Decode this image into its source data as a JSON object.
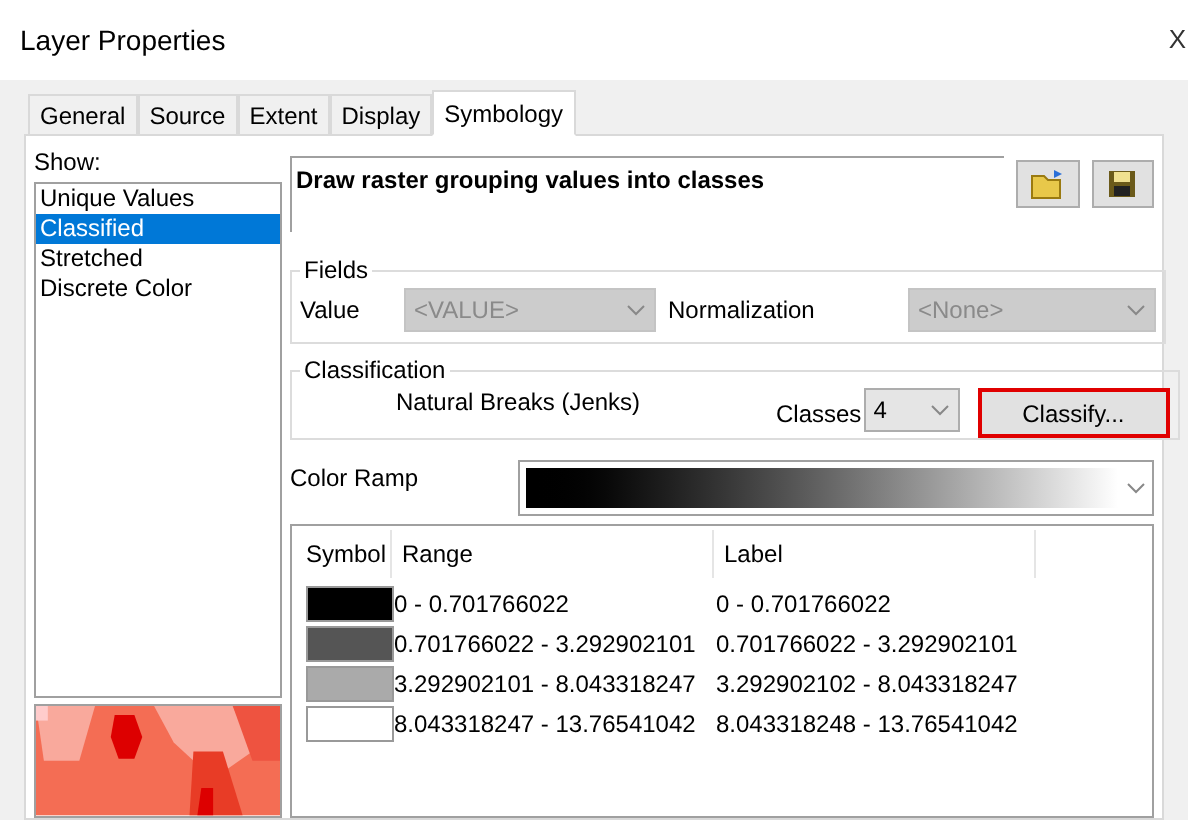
{
  "window": {
    "title": "Layer Properties",
    "close": "X"
  },
  "tabs": [
    {
      "label": "General",
      "selected": false
    },
    {
      "label": "Source",
      "selected": false
    },
    {
      "label": "Extent",
      "selected": false
    },
    {
      "label": "Display",
      "selected": false
    },
    {
      "label": "Symbology",
      "selected": true
    }
  ],
  "show": {
    "label": "Show:",
    "items": [
      {
        "label": "Unique Values",
        "selected": false
      },
      {
        "label": "Classified",
        "selected": true
      },
      {
        "label": "Stretched",
        "selected": false
      },
      {
        "label": "Discrete Color",
        "selected": false
      }
    ]
  },
  "description": "Draw raster grouping values into classes",
  "fields": {
    "title": "Fields",
    "value_label": "Value",
    "value": "<VALUE>",
    "normalization_label": "Normalization",
    "normalization": "<None>"
  },
  "classification": {
    "title": "Classification",
    "method": "Natural Breaks (Jenks)",
    "classes_label": "Classes",
    "classes": "4",
    "classify_button": "Classify..."
  },
  "color_ramp": {
    "label": "Color Ramp"
  },
  "table": {
    "columns": [
      "Symbol",
      "Range",
      "Label"
    ],
    "rows": [
      {
        "color": "#000000",
        "range": "0 - 0.701766022",
        "label": "0 - 0.701766022"
      },
      {
        "color": "#555555",
        "range": "0.701766022 - 3.292902101",
        "label": "0.701766022 - 3.292902101"
      },
      {
        "color": "#aaaaaa",
        "range": "3.292902101 - 8.043318247",
        "label": "3.292902102 - 8.043318247"
      },
      {
        "color": "#ffffff",
        "range": "8.043318247 - 13.76541042",
        "label": "8.043318248 - 13.76541042"
      }
    ]
  }
}
